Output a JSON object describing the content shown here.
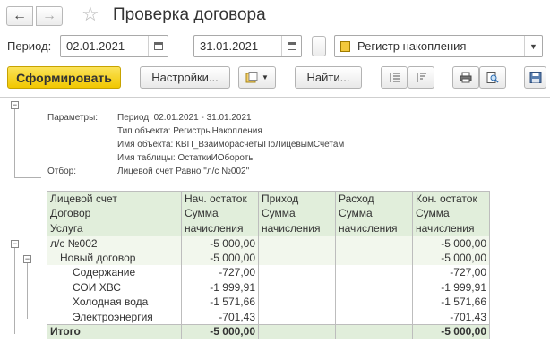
{
  "window": {
    "title": "Проверка договора",
    "back_icon": "arrow-left-icon",
    "forward_icon": "arrow-right-icon",
    "favorite_icon": "star-icon"
  },
  "period": {
    "label": "Период:",
    "from": "02.01.2021",
    "dash": "–",
    "to": "31.01.2021"
  },
  "register_select": {
    "value": "Регистр накопления"
  },
  "toolbar": {
    "generate": "Сформировать",
    "settings": "Настройки...",
    "find": "Найти..."
  },
  "params": {
    "params_label": "Параметры:",
    "period_line": "Период: 02.01.2021 - 31.01.2021",
    "object_type": "Тип объекта: РегистрыНакопления",
    "object_name": "Имя объекта: КВП_ВзаиморасчетыПоЛицевымСчетам",
    "table_name": "Имя таблицы: ОстаткиИОбороты",
    "filter_label": "Отбор:",
    "filter_value": "Лицевой счет Равно \"л/с №002\""
  },
  "table": {
    "headers": {
      "c1r1": "Лицевой счет",
      "c1r2": "Договор",
      "c1r3": "Услуга",
      "c2r1": "Нач. остаток",
      "c2r2": "Сумма",
      "c2r3": "начисления",
      "c3r1": "Приход",
      "c3r2": "Сумма",
      "c3r3": "начисления",
      "c4r1": "Расход",
      "c4r2": "Сумма",
      "c4r3": "начисления",
      "c5r1": "Кон. остаток",
      "c5r2": "Сумма",
      "c5r3": "начисления"
    },
    "rows": [
      {
        "name": "л/с №002",
        "start": "-5 000,00",
        "in": "",
        "out": "",
        "end": "-5 000,00"
      },
      {
        "name": "Новый договор",
        "start": "-5 000,00",
        "in": "",
        "out": "",
        "end": "-5 000,00"
      },
      {
        "name": "Содержание",
        "start": "-727,00",
        "in": "",
        "out": "",
        "end": "-727,00"
      },
      {
        "name": "СОИ ХВС",
        "start": "-1 999,91",
        "in": "",
        "out": "",
        "end": "-1 999,91"
      },
      {
        "name": "Холодная вода",
        "start": "-1 571,66",
        "in": "",
        "out": "",
        "end": "-1 571,66"
      },
      {
        "name": "Электроэнергия",
        "start": "-701,43",
        "in": "",
        "out": "",
        "end": "-701,43"
      }
    ],
    "total": {
      "name": "Итого",
      "start": "-5 000,00",
      "in": "",
      "out": "",
      "end": "-5 000,00"
    }
  }
}
